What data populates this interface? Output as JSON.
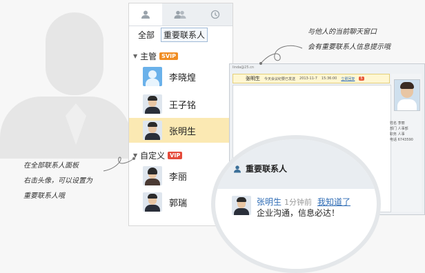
{
  "tabs": [
    {
      "icon": "contact-icon",
      "active": true
    },
    {
      "icon": "group-icon",
      "active": false
    },
    {
      "icon": "history-clock-icon",
      "active": false
    }
  ],
  "filter": {
    "all_label": "全部",
    "important_label": "重要联系人"
  },
  "groups": [
    {
      "name": "主管",
      "badge": "SVIP",
      "contacts": [
        "李晓煌",
        "王子铭",
        "张明生"
      ],
      "selected": "张明生"
    },
    {
      "name": "自定义",
      "badge": "VIP",
      "contacts": [
        "李丽",
        "郭瑞"
      ]
    }
  ],
  "chat_window": {
    "title": "linda@25.cn",
    "bar_name": "张明生",
    "bar_message": "今天会议纪要已发送",
    "bar_date": "2013-11-7",
    "bar_time": "15:36:00",
    "bar_action": "立即回复",
    "bar_count": "5",
    "info": [
      "姓名 李丽",
      "部门 人事部",
      "职务 人事",
      "电话 6743590"
    ]
  },
  "popup": {
    "title": "重要联系人",
    "name": "张明生",
    "time": "1分钟前",
    "dismiss": "我知道了",
    "message": "企业沟通，信息必达！"
  },
  "notes": {
    "top_right": [
      "与他人的当前聊天窗口",
      "会有重要联系人信息提示哦"
    ],
    "left": [
      "在全部联系人面板",
      "右击头像，可以设置为",
      "重要联系人哦"
    ]
  }
}
